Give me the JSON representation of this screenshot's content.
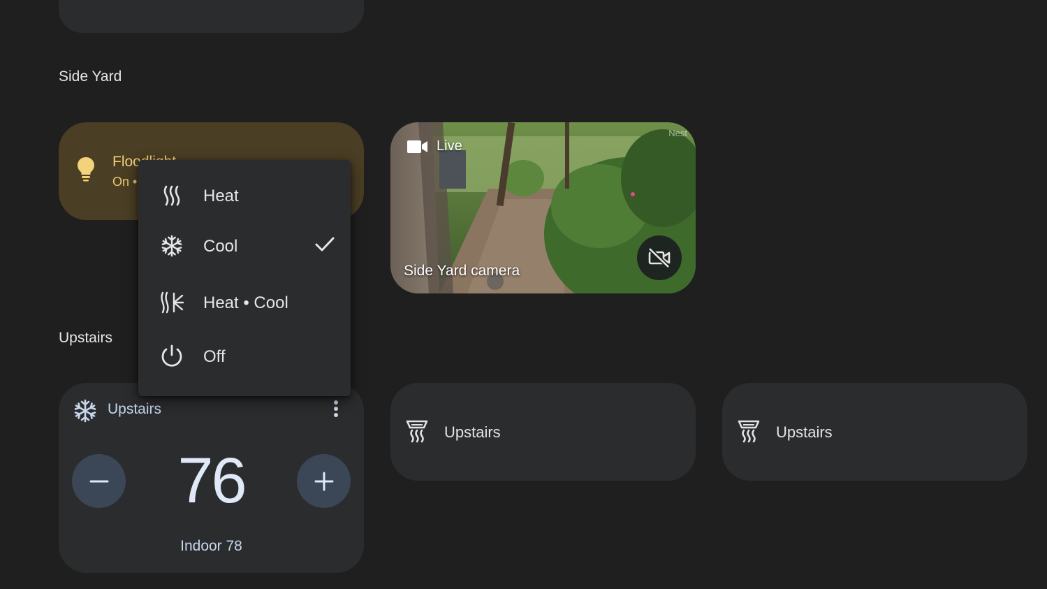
{
  "sections": {
    "side_yard": "Side Yard",
    "upstairs": "Upstairs"
  },
  "floodlight": {
    "name": "Floodlight",
    "status": "On •",
    "icon": "lightbulb-icon",
    "color": "#4a3e24"
  },
  "camera": {
    "live_label": "Live",
    "watermark": "Nest",
    "name": "Side Yard camera",
    "icons": [
      "video-camera-icon",
      "video-off-icon"
    ]
  },
  "thermostat": {
    "name": "Upstairs",
    "mode_icon": "snowflake-icon",
    "setpoint": "76",
    "indoor": "Indoor 78",
    "decrease_icon": "minus-icon",
    "increase_icon": "plus-icon"
  },
  "tiles": [
    {
      "label": "Upstairs",
      "icon": "heater-icon"
    },
    {
      "label": "Upstairs",
      "icon": "heater-icon"
    }
  ],
  "mode_menu": {
    "selected": "Cool",
    "items": [
      {
        "label": "Heat",
        "icon": "heat-icon"
      },
      {
        "label": "Cool",
        "icon": "snowflake-icon"
      },
      {
        "label": "Heat • Cool",
        "icon": "heat-cool-icon"
      },
      {
        "label": "Off",
        "icon": "power-icon"
      }
    ]
  }
}
